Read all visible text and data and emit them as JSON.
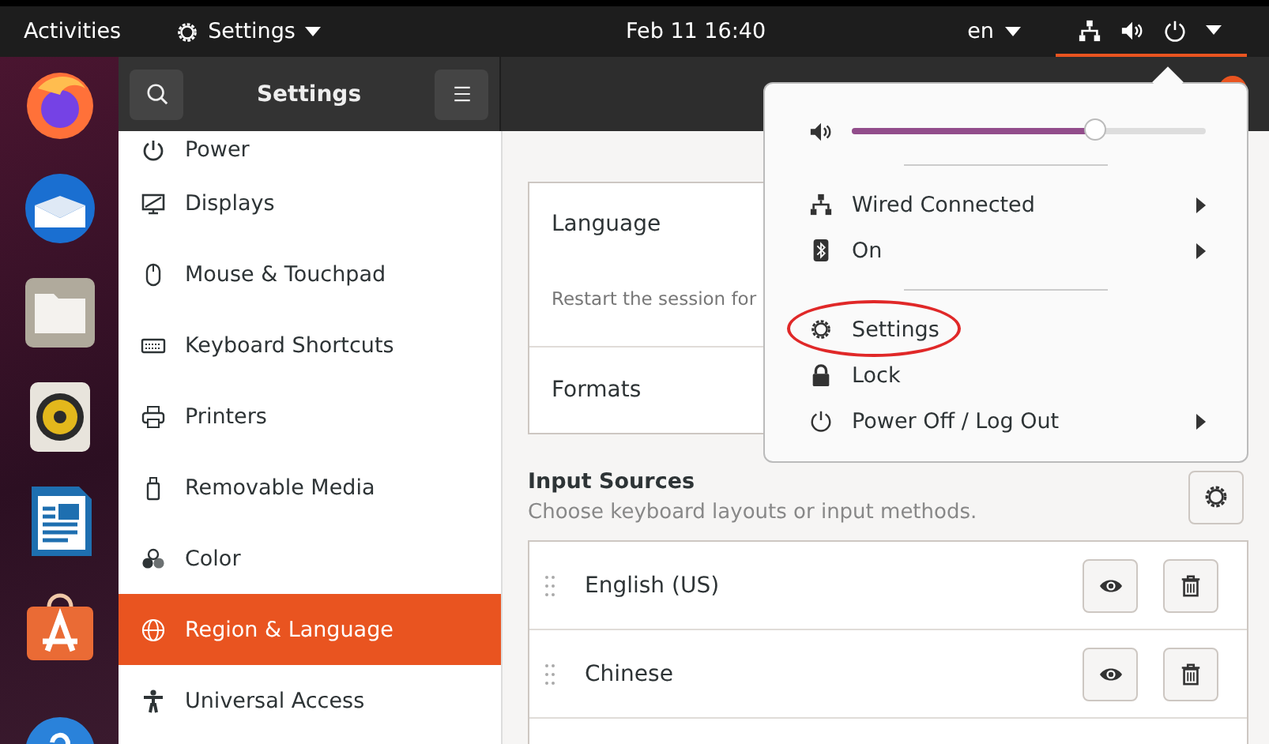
{
  "top_bar": {
    "activities": "Activities",
    "app_menu": "Settings",
    "clock": "Feb 11  16:40",
    "keyboard_layout": "en"
  },
  "dock": {
    "items": [
      {
        "kind": "firefox"
      },
      {
        "kind": "mail"
      },
      {
        "kind": "files"
      },
      {
        "kind": "speaker"
      },
      {
        "kind": "writer"
      },
      {
        "kind": "store"
      },
      {
        "kind": "help"
      }
    ]
  },
  "header": {
    "title": "Settings"
  },
  "sidebar": {
    "items": [
      {
        "label": "Power",
        "kind": "power",
        "selected": false
      },
      {
        "label": "Displays",
        "kind": "display",
        "selected": false
      },
      {
        "label": "Mouse & Touchpad",
        "kind": "mouse",
        "selected": false
      },
      {
        "label": "Keyboard Shortcuts",
        "kind": "keyboard",
        "selected": false
      },
      {
        "label": "Printers",
        "kind": "printer",
        "selected": false
      },
      {
        "label": "Removable Media",
        "kind": "media",
        "selected": false
      },
      {
        "label": "Color",
        "kind": "color",
        "selected": false
      },
      {
        "label": "Region & Language",
        "kind": "globe",
        "selected": true
      },
      {
        "label": "Universal Access",
        "kind": "person",
        "selected": false
      }
    ]
  },
  "language_panel": {
    "language": "Language",
    "restart_note": "Restart the session for",
    "formats": "Formats"
  },
  "input_sources": {
    "title": "Input Sources",
    "subtitle": "Choose keyboard layouts or input methods.",
    "sources": [
      {
        "name": "English (US)"
      },
      {
        "name": "Chinese"
      }
    ]
  },
  "system_menu": {
    "volume": {
      "level": 0.69
    },
    "items": [
      {
        "label": "Wired Connected",
        "kind": "network",
        "submenu": true,
        "circled": false
      },
      {
        "label": "On",
        "kind": "bluetooth",
        "submenu": true,
        "circled": false
      },
      {
        "label": "Settings",
        "kind": "settings",
        "submenu": false,
        "circled": true
      },
      {
        "label": "Lock",
        "kind": "lock",
        "submenu": false,
        "circled": false
      },
      {
        "label": "Power Off / Log Out",
        "kind": "power",
        "submenu": true,
        "circled": false
      }
    ]
  }
}
